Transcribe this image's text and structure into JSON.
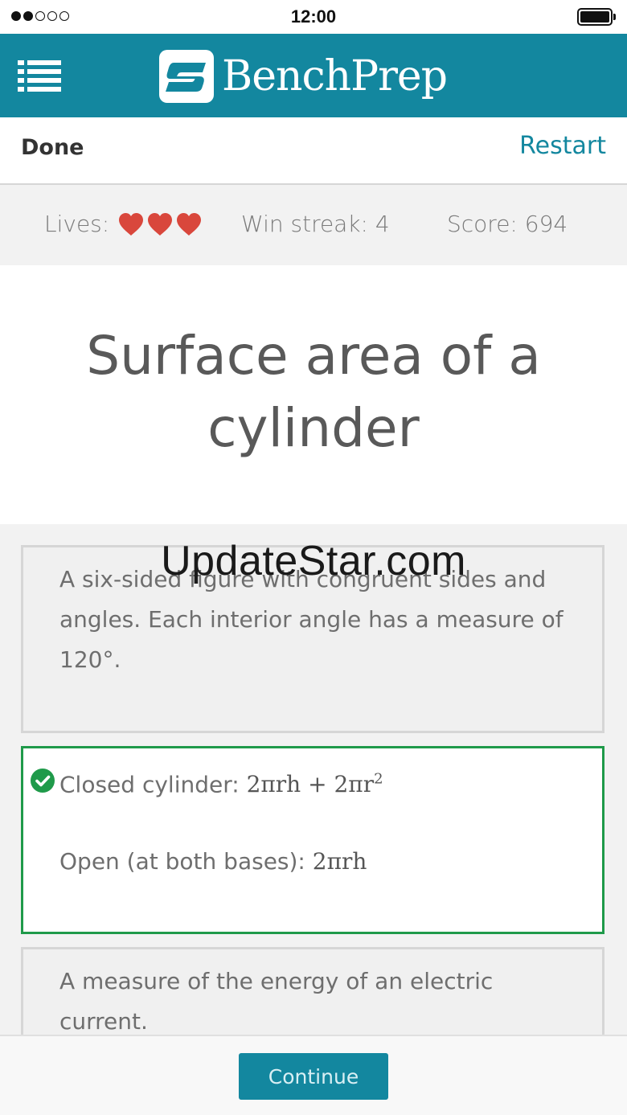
{
  "status_bar": {
    "time": "12:00",
    "signal_filled": 2,
    "signal_total": 5
  },
  "header": {
    "brand": "BenchPrep",
    "brand_color": "#13879f"
  },
  "nav": {
    "done_label": "Done",
    "restart_label": "Restart"
  },
  "stats": {
    "lives_label": "Lives:",
    "lives_count": 3,
    "heart_color": "#d9473c",
    "win_streak": "Win streak: 4",
    "score": "Score: 694"
  },
  "title": "Surface area of a cylinder",
  "cards": [
    {
      "text": "A six-sided figure with congruent sides and angles. Each interior angle has a measure of 120°."
    },
    {
      "line1_label": "Closed cylinder: ",
      "line1_formula": "2πrh + 2πr",
      "line1_exp": "2",
      "line2_label": "Open (at both bases): ",
      "line2_formula": "2πrh",
      "selected": true,
      "correct_color": "#1f9a4a"
    },
    {
      "text": "A measure of the energy of an electric current."
    }
  ],
  "watermark": "UpdateStar.com",
  "footer": {
    "continue_label": "Continue"
  }
}
